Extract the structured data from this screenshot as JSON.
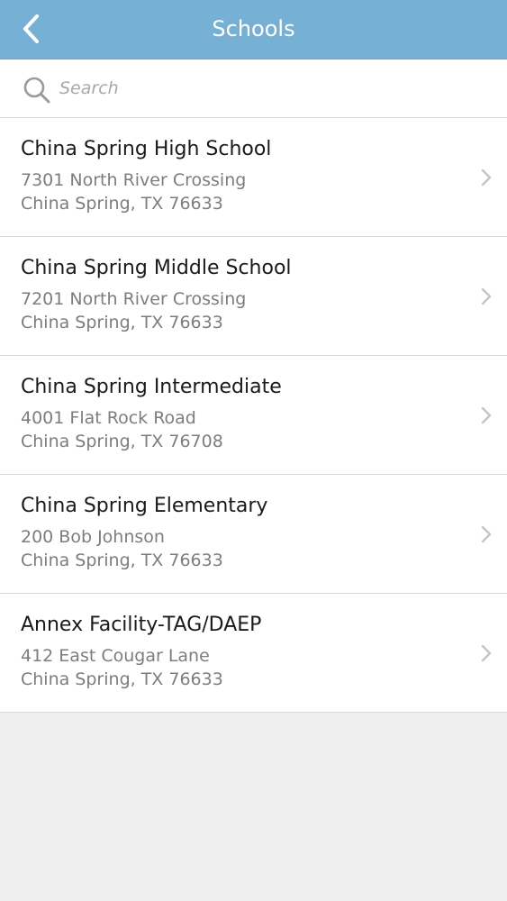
{
  "header": {
    "title": "Schools",
    "back_icon": "chevron-left-icon"
  },
  "search": {
    "placeholder": "Search",
    "value": "",
    "icon": "search-icon"
  },
  "colors": {
    "header_bg": "#76b0d4",
    "page_bg": "#efeff0"
  },
  "schools": [
    {
      "name": "China Spring High School",
      "address1": "7301 North River Crossing",
      "address2": "China Spring, TX 76633"
    },
    {
      "name": "China Spring Middle School",
      "address1": "7201 North River Crossing",
      "address2": "China Spring, TX 76633"
    },
    {
      "name": "China Spring Intermediate",
      "address1": "4001 Flat Rock Road",
      "address2": "China Spring, TX 76708"
    },
    {
      "name": "China Spring Elementary",
      "address1": "200 Bob Johnson",
      "address2": "China Spring, TX 76633"
    },
    {
      "name": "Annex Facility-TAG/DAEP",
      "address1": "412 East Cougar Lane",
      "address2": "China Spring, TX 76633"
    }
  ]
}
